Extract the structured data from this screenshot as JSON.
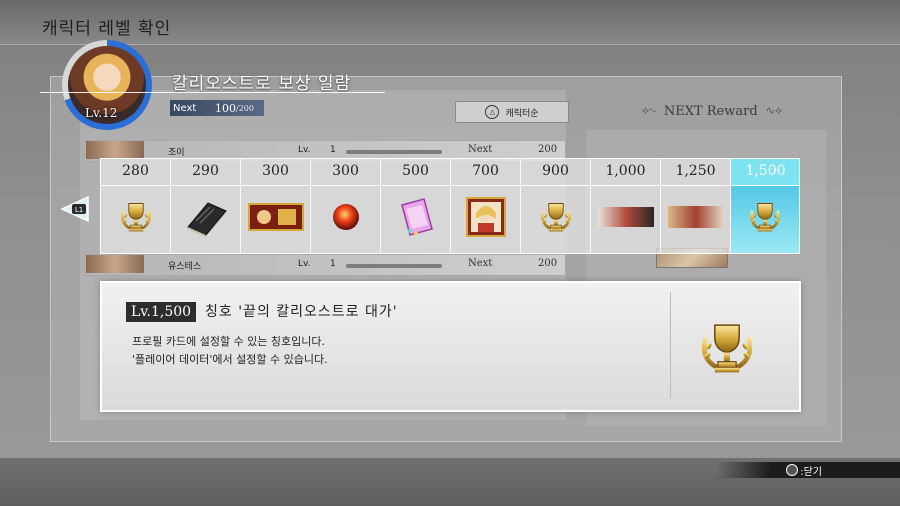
{
  "screen": {
    "title": "캐릭터 레벨 확인"
  },
  "character": {
    "level_text": "Lv.12",
    "next_label": "Next",
    "next_current": "100",
    "next_max": "/200"
  },
  "reward_list": {
    "title": "칼리오스트로   보상 일람",
    "sort_button": "캐릭터순"
  },
  "next_reward": {
    "label": "NEXT Reward"
  },
  "list_rows": [
    {
      "name": "조이",
      "lv_label": "Lv.",
      "lv": "1",
      "next_label": "Next",
      "next_value": "200"
    },
    {
      "name": "유스테스",
      "lv_label": "Lv.",
      "lv": "1",
      "next_label": "Next",
      "next_value": "200"
    }
  ],
  "rewards": [
    {
      "level": "280",
      "icon": "trophy-icon"
    },
    {
      "level": "290",
      "icon": "book-icon"
    },
    {
      "level": "300",
      "icon": "card-icon"
    },
    {
      "level": "300",
      "icon": "orb-icon"
    },
    {
      "level": "500",
      "icon": "crystal-icon"
    },
    {
      "level": "700",
      "icon": "portrait-icon"
    },
    {
      "level": "900",
      "icon": "trophy-icon"
    },
    {
      "level": "1,000",
      "icon": "banner-icon"
    },
    {
      "level": "1,250",
      "icon": "banner-icon"
    },
    {
      "level": "1,500",
      "icon": "trophy-icon",
      "selected": true
    }
  ],
  "prev_button": {
    "label": "L1"
  },
  "detail": {
    "level": "Lv.1,500",
    "name": "칭호 '끝의 칼리오스트로 대가'",
    "desc_line1": "프로필 카드에 설정할 수 있는 칭호입니다.",
    "desc_line2": "'플레이어 데이터'에서 설정할 수 있습니다."
  },
  "close_hint": {
    "label": ":닫기"
  },
  "colors": {
    "selected": "#54c8e6",
    "ring": "#2a6fd6",
    "gold": "#d4a93a"
  }
}
